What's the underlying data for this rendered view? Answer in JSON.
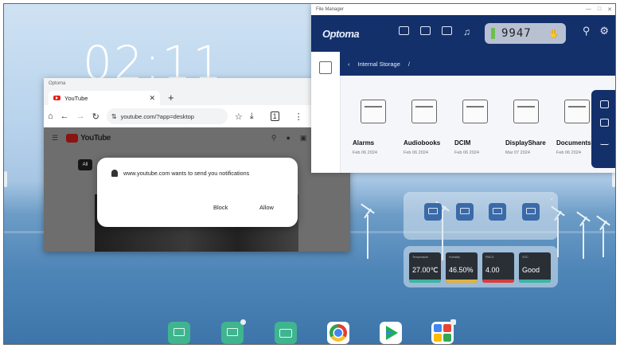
{
  "clock": {
    "time": "02:11"
  },
  "browser": {
    "window_title": "Optoma",
    "tab_label": "YouTube",
    "new_tab_label": "+",
    "url": "youtube.com/?app=desktop",
    "site_logo_text": "YouTube",
    "chip_label": "All"
  },
  "notification_dialog": {
    "message": "www.youtube.com wants to send you notifications",
    "block_label": "Block",
    "allow_label": "Allow"
  },
  "file_manager": {
    "window_title": "File Manager",
    "brand": "Optoma",
    "counter_value": "9947",
    "breadcrumb": "Internal Storage",
    "folders": [
      {
        "name": "Alarms",
        "date": "Feb 06 2024"
      },
      {
        "name": "Audiobooks",
        "date": "Feb 06 2024"
      },
      {
        "name": "DCIM",
        "date": "Feb 06 2024"
      },
      {
        "name": "DisplayShare",
        "date": "Mar 07 2024"
      },
      {
        "name": "Documents",
        "date": "Feb 06 2024"
      }
    ]
  },
  "sensor_widget": {
    "tiles": [
      {
        "label": "Temperature",
        "value": "27.00℃",
        "color": "#3bb6a4"
      },
      {
        "label": "Humidity",
        "value": "46.50%",
        "color": "#e3b23c"
      },
      {
        "label": "PM2.5",
        "value": "4.00",
        "color": "#d93c3c"
      },
      {
        "label": "VOC",
        "value": "Good",
        "color": "#3bb6a4"
      }
    ]
  },
  "colors": {
    "file_manager_header": "#13306b",
    "dock_green": "#3fb58f",
    "accent_red": "#e62117"
  },
  "dock": {
    "icons": [
      "screen-mirror-icon",
      "display-share-icon",
      "file-manager-icon",
      "chrome-icon",
      "play-store-icon",
      "google-apps-icon"
    ]
  }
}
